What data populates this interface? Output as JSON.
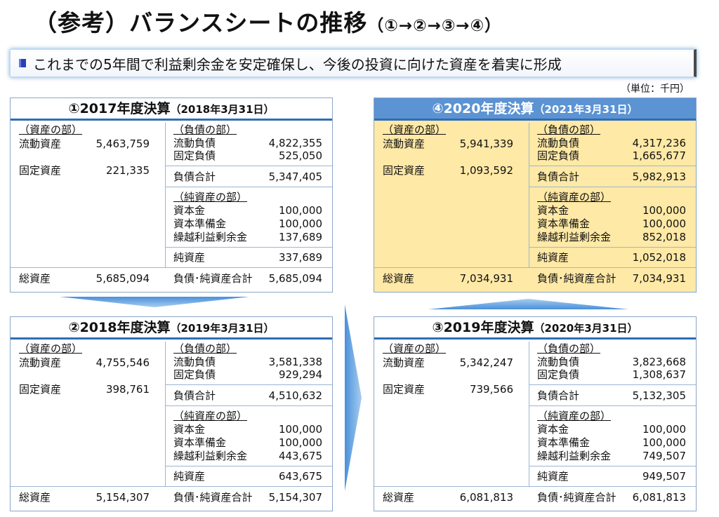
{
  "header": {
    "title": "（参考）バランスシートの推移",
    "title_suffix": "（①→②→③→④）",
    "subtitle": "これまでの5年間で利益剰余金を安定確保し、今後の投資に向けた資産を着実に形成",
    "unit": "（単位：千円）"
  },
  "labels": {
    "assets_section": "（資産の部）",
    "liab_section": "（負債の部）",
    "equity_section": "（純資産の部）",
    "current_assets": "流動資産",
    "fixed_assets": "固定資産",
    "current_liab": "流動負債",
    "fixed_liab": "固定負債",
    "total_liab": "負債合計",
    "capital": "資本金",
    "capital_reserve": "資本準備金",
    "retained": "繰越利益剰余金",
    "net_assets": "純資産",
    "total_assets": "総資産",
    "total_liab_equity": "負債･純資産合計"
  },
  "panels": [
    {
      "title": "①2017年度決算",
      "date": "（2018年3月31日）",
      "current_assets": "5,463,759",
      "fixed_assets": "221,335",
      "current_liab": "4,822,355",
      "fixed_liab": "525,050",
      "total_liab": "5,347,405",
      "capital": "100,000",
      "capital_reserve": "100,000",
      "retained": "137,689",
      "net_assets": "337,689",
      "total_assets": "5,685,094",
      "total_liab_equity": "5,685,094"
    },
    {
      "title": "②2018年度決算",
      "date": "（2019年3月31日）",
      "current_assets": "4,755,546",
      "fixed_assets": "398,761",
      "current_liab": "3,581,338",
      "fixed_liab": "929,294",
      "total_liab": "4,510,632",
      "capital": "100,000",
      "capital_reserve": "100,000",
      "retained": "443,675",
      "net_assets": "643,675",
      "total_assets": "5,154,307",
      "total_liab_equity": "5,154,307"
    },
    {
      "title": "③2019年度決算",
      "date": "（2020年3月31日）",
      "current_assets": "5,342,247",
      "fixed_assets": "739,566",
      "current_liab": "3,823,668",
      "fixed_liab": "1,308,637",
      "total_liab": "5,132,305",
      "capital": "100,000",
      "capital_reserve": "100,000",
      "retained": "749,507",
      "net_assets": "949,507",
      "total_assets": "6,081,813",
      "total_liab_equity": "6,081,813"
    },
    {
      "title": "④2020年度決算",
      "date": "（2021年3月31日）",
      "current_assets": "5,941,339",
      "fixed_assets": "1,093,592",
      "current_liab": "4,317,236",
      "fixed_liab": "1,665,677",
      "total_liab": "5,982,913",
      "capital": "100,000",
      "capital_reserve": "100,000",
      "retained": "852,018",
      "net_assets": "1,052,018",
      "total_assets": "7,034,931",
      "total_liab_equity": "7,034,931"
    }
  ],
  "colors": {
    "highlight_panel_bg": "#ffe9a6",
    "highlight_header_bg": "#5b93d3",
    "accent_blue": "#2f6db5",
    "arrow_blue": "#4a90d9"
  }
}
